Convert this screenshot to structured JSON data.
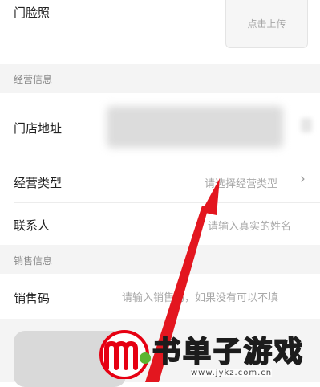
{
  "store_photo": {
    "label": "门脸照",
    "upload_label": "点击上传"
  },
  "section_business": {
    "title": "经营信息"
  },
  "store_address": {
    "label": "门店地址"
  },
  "business_type": {
    "label": "经营类型",
    "placeholder": "请选择经营类型",
    "chevron": "›"
  },
  "contact": {
    "label": "联系人",
    "placeholder": "请输入真实的姓名"
  },
  "section_sales": {
    "title": "销售信息"
  },
  "sales_code": {
    "label": "销售码",
    "placeholder": "请输入销售码，如果没有可以不填"
  },
  "watermark": {
    "brand_text": "书单子游戏",
    "url": "www.jykz.com.cn"
  },
  "colors": {
    "arrow": "#e3161f",
    "section_bg": "#f4f4f4",
    "placeholder": "#a8a8a8",
    "logo_red": "#e60012",
    "logo_green": "#5cb531"
  }
}
